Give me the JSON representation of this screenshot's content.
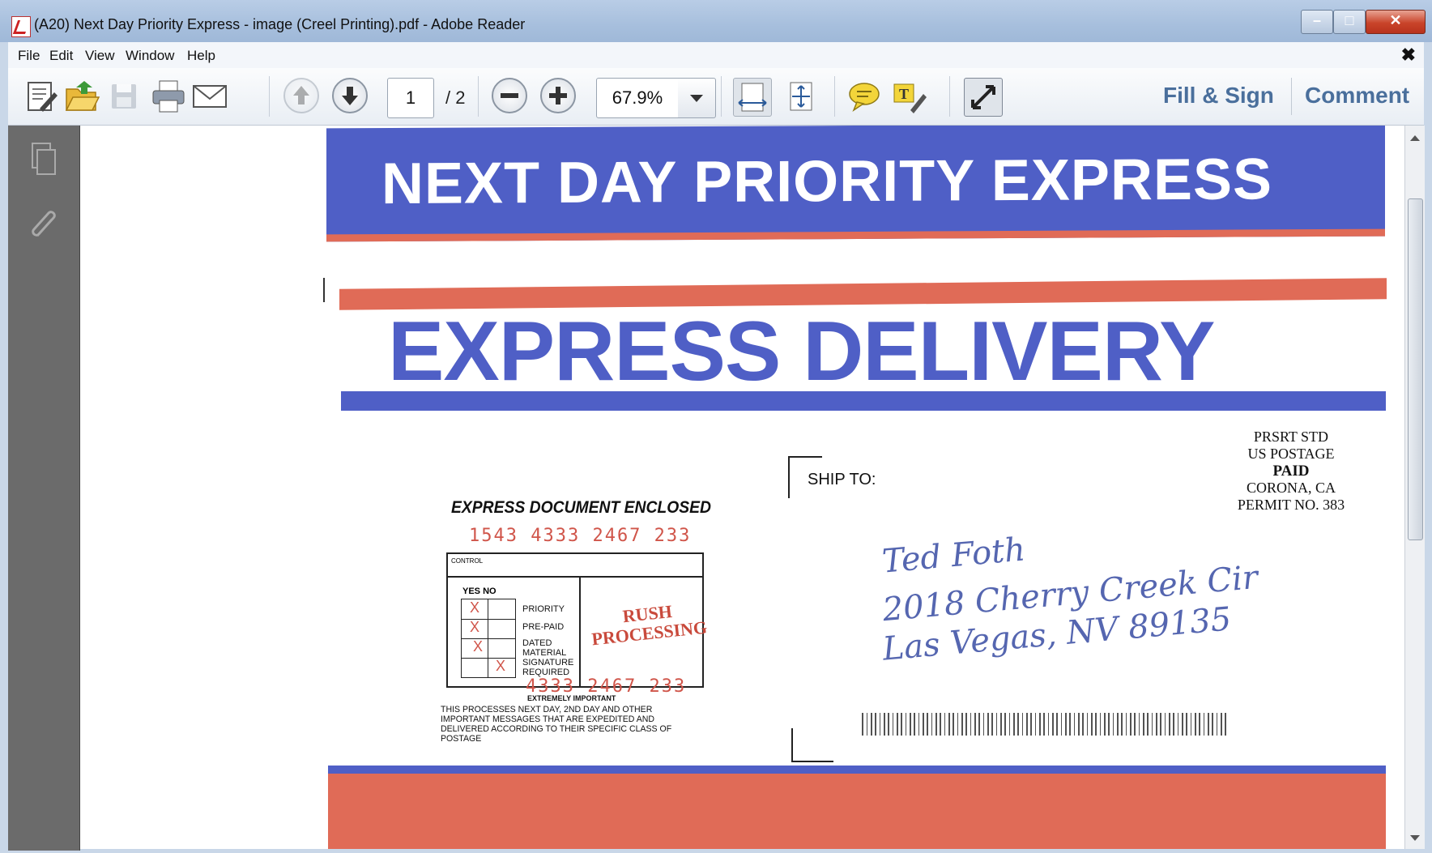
{
  "window": {
    "title": "(A20) Next Day Priority Express - image (Creel Printing).pdf - Adobe Reader"
  },
  "menu": {
    "items": [
      "File",
      "Edit",
      "View",
      "Window",
      "Help"
    ]
  },
  "toolbar": {
    "page_current": "1",
    "page_total": "/ 2",
    "zoom": "67.9%",
    "fill_sign_label": "Fill & Sign",
    "comment_label": "Comment"
  },
  "document": {
    "banner_top": "NEXT DAY PRIORITY EXPRESS",
    "banner_main": "EXPRESS DELIVERY",
    "postage": {
      "line1": "PRSRT STD",
      "line2": "US POSTAGE",
      "line3": "PAID",
      "line4": "CORONA, CA",
      "line5": "PERMIT NO. 383"
    },
    "ship_to_label": "SHIP TO:",
    "handwritten_lines": [
      "Ted Foth",
      "2018 Cherry Creek Cir",
      "Las Vegas, NV 89135"
    ],
    "doc_enclosed": "EXPRESS DOCUMENT ENCLOSED",
    "control_number_top": "1543 4333 2467 233",
    "control_number_bottom": "4333 2467 233",
    "control_label": "CONTROL",
    "yes_no": "YES   NO",
    "options": [
      "PRIORITY",
      "PRE-PAID",
      "DATED MATERIAL",
      "SIGNATURE REQUIRED"
    ],
    "stamp_line1": "RUSH",
    "stamp_line2": "PROCESSING",
    "important": "EXTREMELY IMPORTANT",
    "fine_print": "THIS PROCESSES NEXT DAY, 2ND DAY AND OTHER IMPORTANT MESSAGES THAT ARE EXPEDITED AND DELIVERED ACCORDING TO THEIR SPECIFIC CLASS OF POSTAGE"
  },
  "icons": {
    "toolbar": [
      "create-pdf-icon",
      "open-icon",
      "save-icon",
      "print-icon",
      "email-icon",
      "previous-page-icon",
      "next-page-icon",
      "zoom-out-icon",
      "zoom-in-icon",
      "fit-width-icon",
      "fit-page-icon",
      "sticky-note-icon",
      "highlight-text-icon",
      "full-screen-icon"
    ],
    "nav": [
      "pages-icon",
      "attachments-icon"
    ]
  }
}
